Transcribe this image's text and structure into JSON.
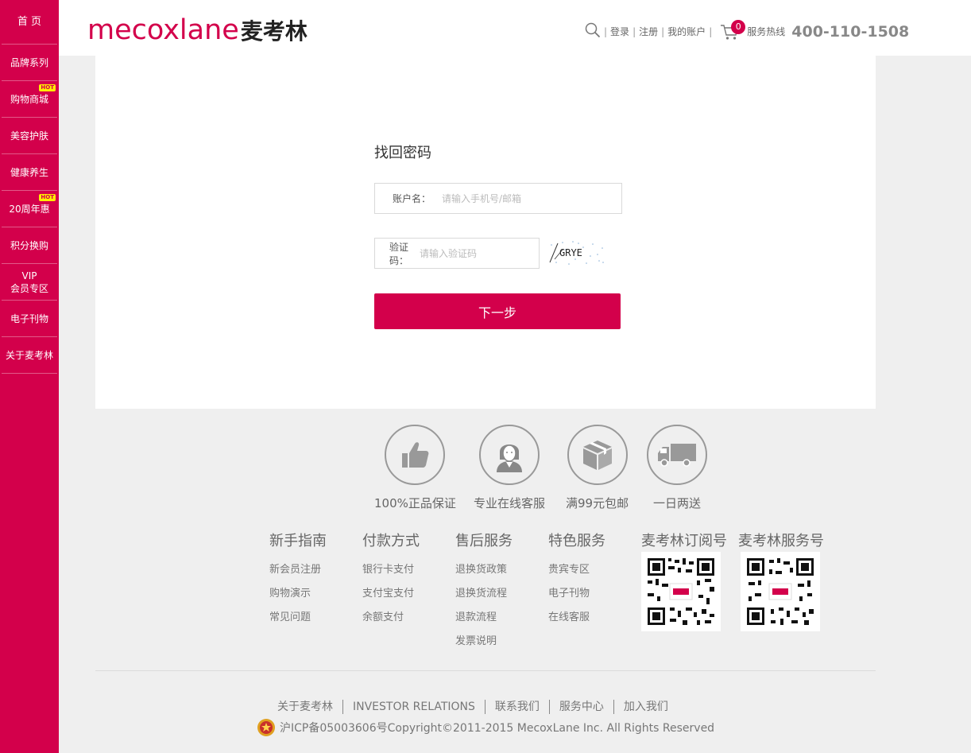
{
  "sidebar": {
    "items": [
      {
        "label": "首 页",
        "hot": false
      },
      {
        "label": "品牌系列",
        "hot": false
      },
      {
        "label": "购物商城",
        "hot": true
      },
      {
        "label": "美容护肤",
        "hot": false
      },
      {
        "label": "健康养生",
        "hot": false
      },
      {
        "label": "20周年惠",
        "hot": true
      },
      {
        "label": "积分换购",
        "hot": false
      },
      {
        "label": "VIP",
        "label2": "会员专区",
        "hot": false
      },
      {
        "label": "电子刊物",
        "hot": false
      },
      {
        "label": "关于麦考林",
        "hot": false
      }
    ],
    "hot_label": "HOT"
  },
  "header": {
    "logo_en": "mecoxlane",
    "logo_cn": "麦考林",
    "search_icon": "search-icon",
    "login": "登录",
    "register": "注册",
    "my_account": "我的账户",
    "cart_icon": "cart-icon",
    "cart_count": "0",
    "hotline_label": "服务热线",
    "hotline_number": "400-110-1508"
  },
  "form": {
    "title": "找回密码",
    "account_label": "账户名：",
    "account_placeholder": "请输入手机号/邮箱",
    "captcha_label": "验证码：",
    "captcha_placeholder": "请输入验证码",
    "captcha_text": "GRYE",
    "next_button": "下一步"
  },
  "features": [
    {
      "icon": "thumbs-up-icon",
      "label": "100%正品保证"
    },
    {
      "icon": "customer-service-icon",
      "label": "专业在线客服"
    },
    {
      "icon": "package-icon",
      "label": "满99元包邮"
    },
    {
      "icon": "truck-icon",
      "label": "一日两送"
    }
  ],
  "footer_columns": [
    {
      "title": "新手指南",
      "links": [
        "新会员注册",
        "购物演示",
        "常见问题"
      ]
    },
    {
      "title": "付款方式",
      "links": [
        "银行卡支付",
        "支付宝支付",
        "余额支付"
      ]
    },
    {
      "title": "售后服务",
      "links": [
        "退换货政策",
        "退换货流程",
        "退款流程",
        "发票说明"
      ]
    },
    {
      "title": "特色服务",
      "links": [
        "贵宾专区",
        "电子刊物",
        "在线客服"
      ]
    }
  ],
  "qr": [
    {
      "title": "麦考林订阅号"
    },
    {
      "title": "麦考林服务号"
    }
  ],
  "bottom_links": [
    "关于麦考林",
    "INVESTOR RELATIONS",
    "联系我们",
    "服务中心",
    "加入我们"
  ],
  "copyright": "沪ICP备05003606号Copyright©2011-2015 MecoxLane Inc. All Rights Reserved",
  "colors": {
    "brand": "#d3004b",
    "background": "#efefef"
  }
}
